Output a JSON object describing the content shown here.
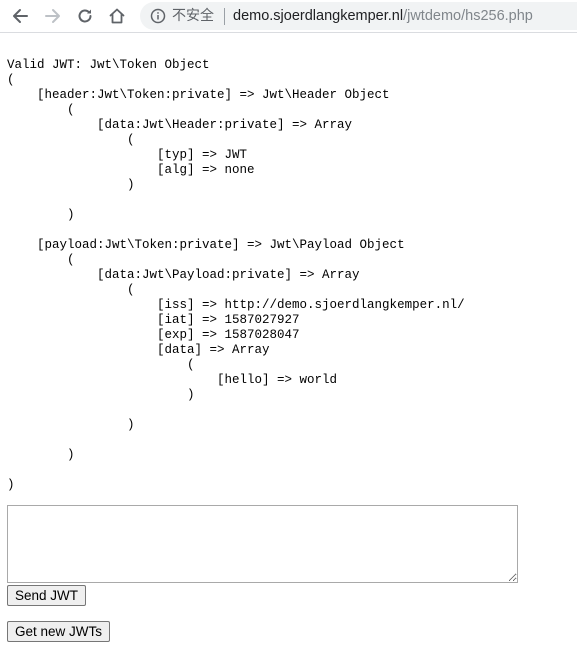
{
  "browser": {
    "security_label": "不安全",
    "url_host": "demo.sjoerdlangkemper.nl",
    "url_path": "/jwtdemo/hs256.php"
  },
  "output": {
    "text": "Valid JWT: Jwt\\Token Object\n(\n    [header:Jwt\\Token:private] => Jwt\\Header Object\n        (\n            [data:Jwt\\Header:private] => Array\n                (\n                    [typ] => JWT\n                    [alg] => none\n                )\n\n        )\n\n    [payload:Jwt\\Token:private] => Jwt\\Payload Object\n        (\n            [data:Jwt\\Payload:private] => Array\n                (\n                    [iss] => http://demo.sjoerdlangkemper.nl/\n                    [iat] => 1587027927\n                    [exp] => 1587028047\n                    [data] => Array\n                        (\n                            [hello] => world\n                        )\n\n                )\n\n        )\n\n)"
  },
  "form": {
    "jwt_value": "",
    "send_label": "Send JWT",
    "new_label": "Get new JWTs"
  }
}
